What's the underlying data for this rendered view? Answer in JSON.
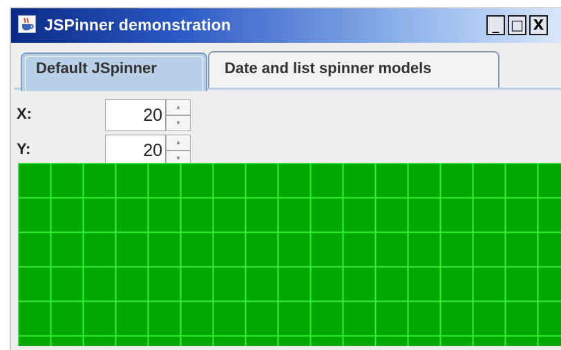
{
  "window": {
    "title": "JSPinner demonstration"
  },
  "titlebar_buttons": {
    "minimize": "_",
    "maximize": "□",
    "close": "X"
  },
  "tabs": [
    {
      "label": "Default JSpinner",
      "selected": true
    },
    {
      "label": "Date and list spinner models",
      "selected": false
    }
  ],
  "spinners": [
    {
      "label": "X:",
      "value": "20"
    },
    {
      "label": "Y:",
      "value": "20"
    }
  ],
  "canvas": {
    "fill_color": "#00a800",
    "line_color": "#36ef36"
  },
  "icons": {
    "app": "java-cup-icon",
    "up": "spinner-up-arrow",
    "down": "spinner-down-arrow"
  }
}
